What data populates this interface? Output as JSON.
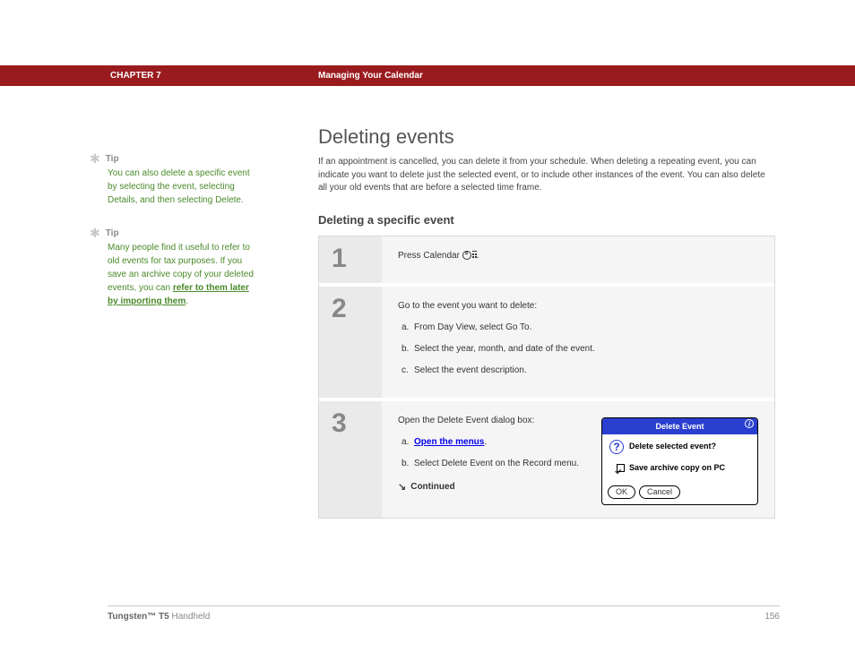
{
  "header": {
    "chapter": "CHAPTER 7",
    "section": "Managing Your Calendar"
  },
  "sidebar": {
    "tips": [
      {
        "label": "Tip",
        "body_plain": "You can also delete a specific event by selecting the event, selecting Details, and then selecting Delete."
      },
      {
        "label": "Tip",
        "body_prefix": "Many people find it useful to refer to old events for tax purposes. If you save an archive copy of your deleted events, you can ",
        "link_text": "refer to them later by importing them",
        "body_suffix": "."
      }
    ]
  },
  "main": {
    "title": "Deleting events",
    "intro": "If an appointment is cancelled, you can delete it from your schedule. When deleting a repeating event, you can indicate you want to delete just the selected event, or to include other instances of the event. You can also delete all your old events that are before a selected time frame.",
    "subsection": "Deleting a specific event",
    "steps": [
      {
        "num": "1",
        "lead": "Press Calendar ",
        "trail": "."
      },
      {
        "num": "2",
        "lead": "Go to the event you want to delete:",
        "subitems": [
          {
            "letter": "a.",
            "text": "From Day View, select Go To."
          },
          {
            "letter": "b.",
            "text": "Select the year, month, and date of the event."
          },
          {
            "letter": "c.",
            "text": "Select the event description."
          }
        ]
      },
      {
        "num": "3",
        "lead": "Open the Delete Event dialog box:",
        "subitems": [
          {
            "letter": "a.",
            "link": "Open the menus",
            "suffix": "."
          },
          {
            "letter": "b.",
            "text": "Select Delete Event on the Record menu."
          }
        ],
        "continued": "Continued",
        "dialog": {
          "title": "Delete Event",
          "question": "Delete selected event?",
          "checkbox": "Save archive copy on PC",
          "ok": "OK",
          "cancel": "Cancel"
        }
      }
    ]
  },
  "footer": {
    "product_bold": "Tungsten™ T5",
    "product_rest": " Handheld",
    "page": "156"
  }
}
